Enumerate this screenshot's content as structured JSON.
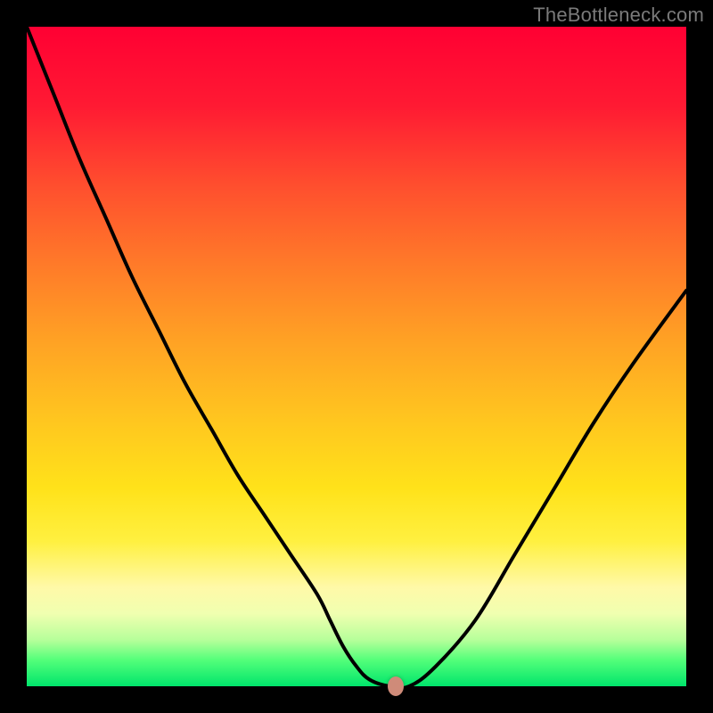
{
  "watermark": "TheBottleneck.com",
  "chart_data": {
    "type": "line",
    "title": "",
    "xlabel": "",
    "ylabel": "",
    "xlim": [
      0,
      100
    ],
    "ylim": [
      0,
      100
    ],
    "grid": false,
    "legend": false,
    "series": [
      {
        "name": "bottleneck-curve",
        "x": [
          0,
          4,
          8,
          12,
          16,
          20,
          24,
          28,
          32,
          36,
          40,
          44,
          46,
          48,
          50,
          52,
          55,
          58,
          62,
          68,
          74,
          80,
          86,
          92,
          100
        ],
        "y": [
          100,
          90,
          80,
          71,
          62,
          54,
          46,
          39,
          32,
          26,
          20,
          14,
          10,
          6,
          3,
          1,
          0,
          0,
          3,
          10,
          20,
          30,
          40,
          49,
          60
        ]
      }
    ],
    "marker": {
      "x": 56,
      "y": 0,
      "color": "#cf8b79"
    },
    "background_gradient": [
      "#ff0033",
      "#ffe21a",
      "#00e56b"
    ]
  }
}
